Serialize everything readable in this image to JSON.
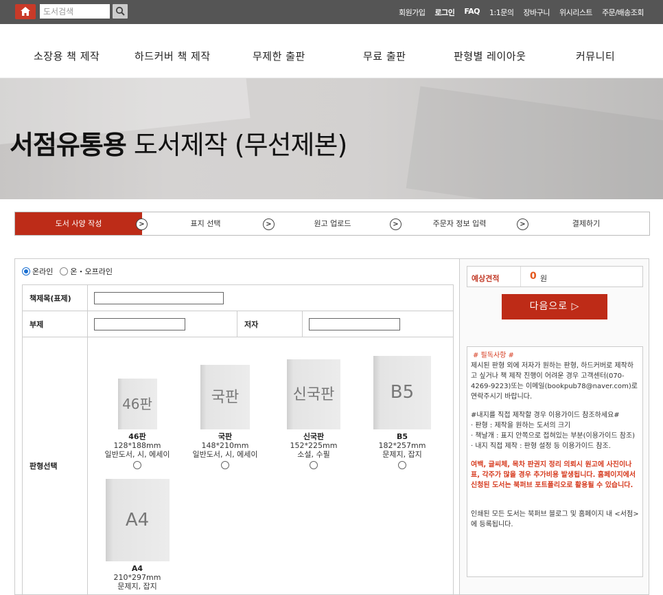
{
  "topbar": {
    "search_placeholder": "도서검색",
    "links": [
      "회원가입",
      "로그인",
      "FAQ",
      "1:1문의",
      "장바구니",
      "위시리스트",
      "주문/배송조회"
    ]
  },
  "nav": {
    "items": [
      "소장용 책 제작",
      "하드커버 책 제작",
      "무제한 출판",
      "무료 출판",
      "판형별 레이아웃",
      "커뮤니티"
    ]
  },
  "hero": {
    "title_bold": "서점유통용",
    "title_rest": " 도서제작 (무선제본)"
  },
  "steps": {
    "items": [
      "도서 사양 작성",
      "표지 선택",
      "원고 업로드",
      "주문자 정보 입력",
      "결제하기"
    ],
    "arrow": ">"
  },
  "form": {
    "radio_online": "온라인",
    "radio_offline": "온・오프라인",
    "title_label": "책제목(표제)",
    "subtitle_label": "부제",
    "author_label": "저자",
    "size_label": "판형선택",
    "sizes": [
      {
        "cover": "46판",
        "name": "46판",
        "dims": "128*188mm",
        "desc": "일반도서, 시, 에세이"
      },
      {
        "cover": "국판",
        "name": "국판",
        "dims": "148*210mm",
        "desc": "일반도서, 시, 에세이"
      },
      {
        "cover": "신국판",
        "name": "신국판",
        "dims": "152*225mm",
        "desc": "소설, 수필"
      },
      {
        "cover": "B5",
        "name": "B5",
        "dims": "182*257mm",
        "desc": "문제지, 잡지"
      },
      {
        "cover": "A4",
        "name": "A4",
        "dims": "210*297mm",
        "desc": "문제지, 잡지"
      }
    ]
  },
  "sidebar": {
    "estimate_label": "예상견적",
    "estimate_value": "0",
    "estimate_unit": "원",
    "next_button": "다음으로 ▷",
    "notice": {
      "heading": "# 필독사항 #",
      "p1": "제시된 판형 외에 저자가 원하는 판형, 하드커버로 제작하고 싶거나 책 제작 진행이 어려운 경우 고객센터(070-4269-9223)또는 이메일(bookpub78@naver.com)로 연락주시기 바랍니다.",
      "p2_heading": "#내지를 직접 제작할 경우 이용가이드 참조하세요#",
      "p2_items": [
        "· 판형 : 제작을 원하는 도서의 크기",
        "· 책날개 : 표지 안쪽으로 접혀있는 부분(이용가이드 참조)",
        "· 내지 직접 제작 : 판형 설정 등 이용가이드 참조."
      ],
      "p3": "여백, 글씨체, 목차 판권지 정리 의뢰시 원고에 사진이나 표, 각주가 많을 경우 추가비용 발생됩니다. 홈페이지에서 신청된 도서는 북퍼브 포트폴리오로 활용될 수 있습니다.",
      "p4": "인쇄된 모든 도서는 북퍼브 블로그 및 홈페이지 내 <서점>에 등록됩니다."
    }
  },
  "colors": {
    "accent": "#bd2c18",
    "topbar": "#555555",
    "estimate_value": "#e4581d"
  }
}
